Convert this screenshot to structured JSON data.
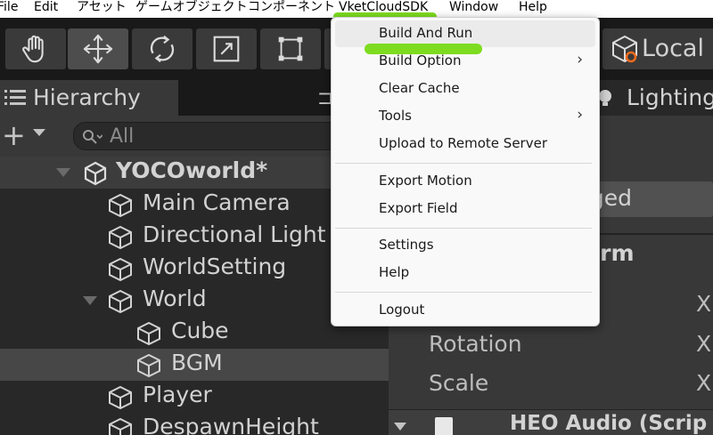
{
  "menubar": {
    "items": [
      "File",
      "Edit",
      "アセット",
      "ゲームオブジェクト",
      "コンポーネント",
      "VketCloudSDK",
      "Window",
      "Help"
    ]
  },
  "toolbar": {
    "tools": [
      "hand-icon",
      "move-icon",
      "rotate-icon",
      "scale-icon",
      "rect-icon"
    ],
    "active_tool": "move-icon",
    "pivot_label": "Local"
  },
  "hierarchy": {
    "tab_label": "Hierarchy",
    "search_placeholder": "All",
    "scene_name": "YOCOworld*",
    "items": [
      {
        "label": "Main Camera"
      },
      {
        "label": "Directional Light"
      },
      {
        "label": "WorldSetting"
      },
      {
        "label": "World"
      },
      {
        "label": "Cube"
      },
      {
        "label": "BGM"
      },
      {
        "label": "Player"
      },
      {
        "label": "DespawnHeight"
      }
    ],
    "selected": "BGM"
  },
  "inspector": {
    "lighting_tab_label": "Lighting",
    "tag_value": "gged",
    "transform_title": "orm",
    "properties": [
      "Rotation",
      "Scale"
    ],
    "axis_label": "X",
    "audio_component_title": "HEO Audio (Scrip"
  },
  "dropdown": {
    "items": [
      {
        "label": "Build And Run",
        "submenu": false
      },
      {
        "label": "Build Option",
        "submenu": true
      },
      {
        "label": "Clear Cache",
        "submenu": false
      },
      {
        "label": "Tools",
        "submenu": true
      },
      {
        "label": "Upload to Remote Server",
        "submenu": false
      },
      {
        "label": "Export Motion",
        "submenu": false
      },
      {
        "label": "Export Field",
        "submenu": false
      },
      {
        "label": "Settings",
        "submenu": false
      },
      {
        "label": "Help",
        "submenu": false
      },
      {
        "label": "Logout",
        "submenu": false
      }
    ],
    "submenu_arrow": "›"
  },
  "colors": {
    "highlight": "#7ddc1f",
    "panel_dark": "#282828",
    "panel": "#383838",
    "menu_bg": "#f9f9f9"
  }
}
